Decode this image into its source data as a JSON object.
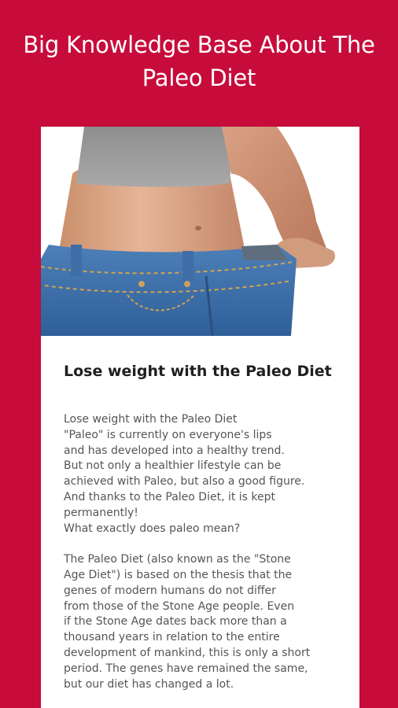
{
  "header": {
    "title": "Big Knowledge Base About The\nPaleo Diet"
  },
  "article": {
    "image": "woman-waist-loose-jeans-photo",
    "title": "Lose weight with the Paleo Diet",
    "body": "Lose weight with the Paleo Diet\n\"Paleo\" is currently on everyone's lips\nand has developed into a healthy trend.\nBut not only a healthier lifestyle can be\nachieved with Paleo, but also a good figure.\nAnd thanks to the Paleo Diet, it is kept\npermanently!\nWhat exactly does paleo mean?\n\nThe Paleo Diet (also known as the \"Stone\nAge Diet\") is based on the thesis that the\ngenes of modern humans do not differ\nfrom those of the Stone Age people. Even\nif the Stone Age dates back more than a\nthousand years in relation to the entire\ndevelopment of mankind, this is only a short\nperiod. The genes have remained the same,\nbut our diet has changed a lot."
  },
  "colors": {
    "background": "#c70c3c",
    "card": "#ffffff",
    "title_text": "#1f1f1f",
    "body_text": "#555555"
  }
}
